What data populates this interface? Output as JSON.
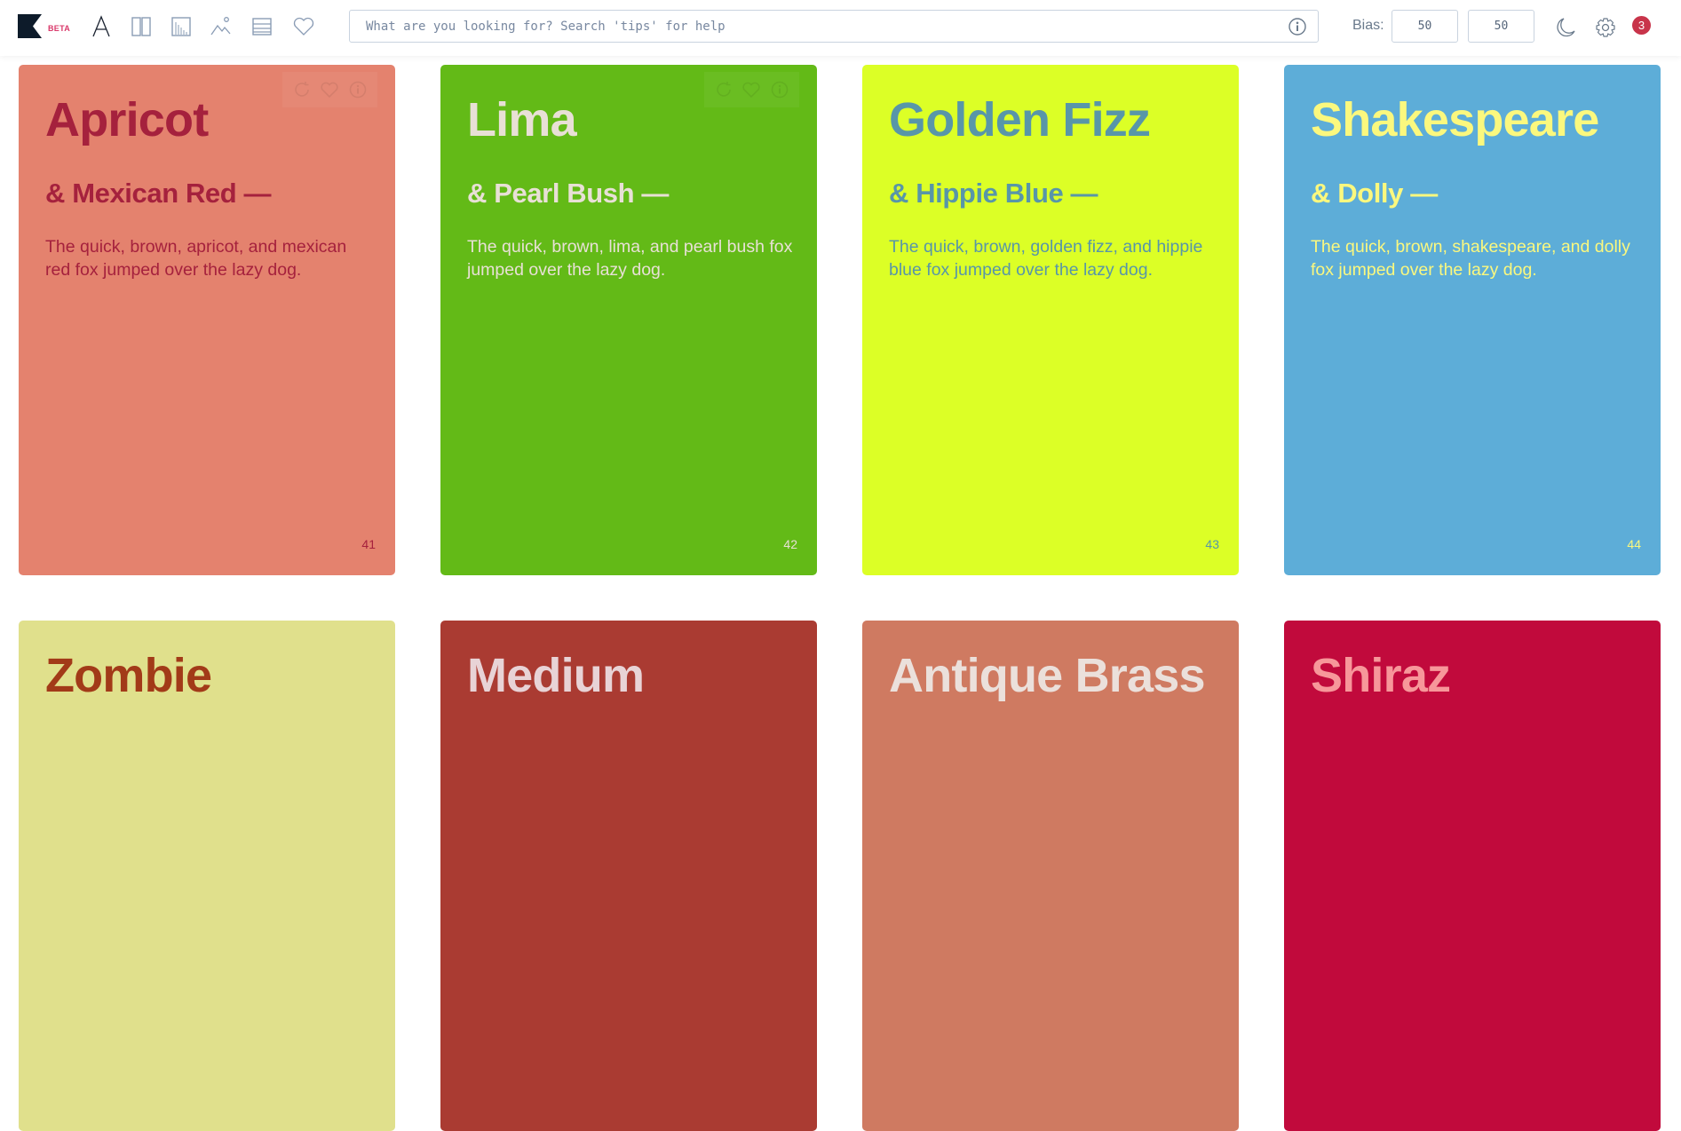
{
  "app": {
    "beta_label": "BETA",
    "nav_icons": [
      "type-icon",
      "columns-icon",
      "chart-icon",
      "image-icon",
      "list-icon",
      "heart-icon"
    ]
  },
  "search": {
    "value": "",
    "placeholder": "What are you looking for? Search 'tips' for help"
  },
  "bias": {
    "label": "Bias:",
    "value1": "50",
    "value2": "50"
  },
  "notifications": {
    "count": "3"
  },
  "colors": {
    "brand_dark": "#0d1b2a",
    "beta": "#d9386a",
    "badge": "#c8344a"
  },
  "cards": [
    {
      "title": "Apricot",
      "subtitle": "& Mexican Red —",
      "body": "The quick, brown, apricot, and mexican red fox jumped over the lazy dog.",
      "number": "41",
      "bg": "#e4826e",
      "fg": "#a5213d",
      "show_actions": true
    },
    {
      "title": "Lima",
      "subtitle": "& Pearl Bush —",
      "body": "The quick, brown, lima, and pearl bush fox jumped over the lazy dog.",
      "number": "42",
      "bg": "#63ba17",
      "fg": "#e8e0d6",
      "show_actions": true
    },
    {
      "title": "Golden Fizz",
      "subtitle": "& Hippie Blue —",
      "body": "The quick, brown, golden fizz, and hippie blue fox jumped over the lazy dog.",
      "number": "43",
      "bg": "#dcff26",
      "fg": "#5896a8",
      "show_actions": false
    },
    {
      "title": "Shakespeare",
      "subtitle": "& Dolly —",
      "body": "The quick, brown, shakespeare, and dolly fox jumped over the lazy dog.",
      "number": "44",
      "bg": "#5dadd8",
      "fg": "#fbf87e",
      "show_actions": false
    },
    {
      "title": "Zombie",
      "bg": "#e0e08c",
      "fg": "#a23a18"
    },
    {
      "title": "Medium",
      "bg": "#aa3b32",
      "fg": "#e8d3d6"
    },
    {
      "title": "Antique Brass",
      "bg": "#cf7a61",
      "fg": "#ebe0db"
    },
    {
      "title": "Shiraz",
      "bg": "#c10a3c",
      "fg": "#f7979a"
    }
  ]
}
